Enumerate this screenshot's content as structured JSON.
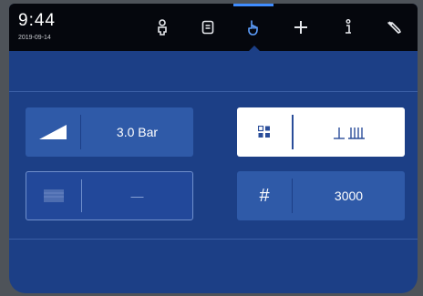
{
  "status": {
    "time": "9:44",
    "date": "2019-09-14"
  },
  "tabs": [
    {
      "icon": "person-icon"
    },
    {
      "icon": "document-icon"
    },
    {
      "icon": "hand-touch-icon",
      "active": true
    },
    {
      "icon": "plus-icon"
    },
    {
      "icon": "info-icon"
    },
    {
      "icon": "wrench-icon"
    }
  ],
  "pressure": {
    "value": "3.0 Bar"
  },
  "empty_setting": {
    "value": "—"
  },
  "count": {
    "symbol": "#",
    "value": "3000"
  },
  "colors": {
    "screen": "#1c3f86",
    "topbar": "#05070d",
    "card": "#2f5aa8",
    "active_tab": "#3f8cff"
  }
}
